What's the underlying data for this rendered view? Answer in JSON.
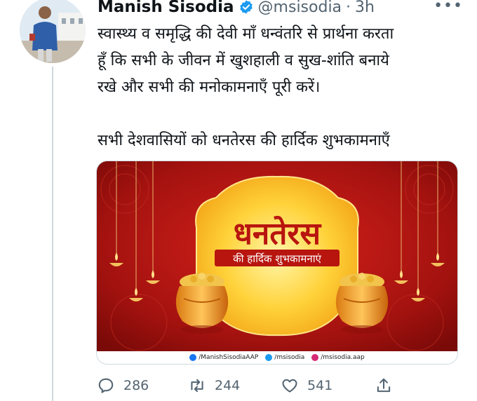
{
  "tweet": {
    "author_name": "Manish Sisodia",
    "handle": "@msisodia",
    "separator": "·",
    "time": "3h",
    "more": "•••",
    "text_line1": "स्वास्थ्य व समृद्धि की देवी माँ धन्वंतरि से प्रार्थना करता",
    "text_line2": "हूँ कि सभी के जीवन में खुशहाली व सुख-शांति बनाये",
    "text_line3": "रखे और सभी की मनोकामनाएँ पूरी करें।",
    "text_line4": "सभी देशवासियों को धनतेरस की हार्दिक शुभकामनाएँ"
  },
  "poster": {
    "title": "धनतेरस",
    "subtitle": "की हार्दिक शुभकामनाएं",
    "social": [
      {
        "label": "/ManishSisodiaAAP",
        "color": "#1877f2"
      },
      {
        "label": "/msisodia",
        "color": "#1d9bf0"
      },
      {
        "label": "/msisodia.aap",
        "color": "#d62976"
      }
    ]
  },
  "actions": {
    "replies": "286",
    "retweets": "244",
    "likes": "541"
  }
}
